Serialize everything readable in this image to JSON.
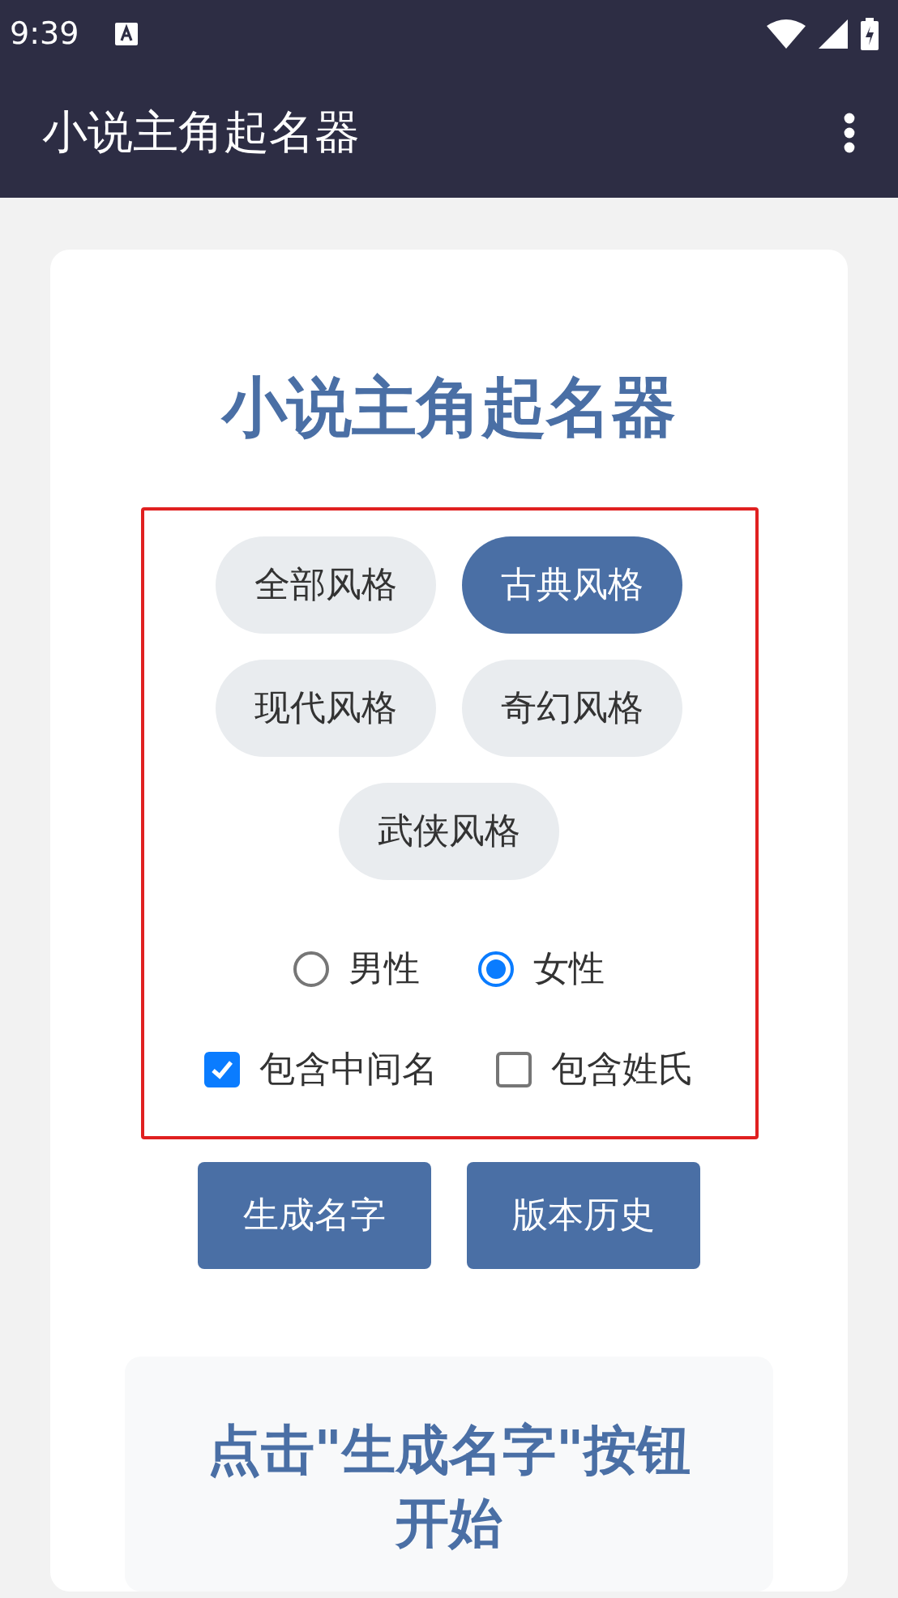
{
  "status_bar": {
    "time": "9:39"
  },
  "app_bar": {
    "title": "小说主角起名器"
  },
  "card": {
    "title": "小说主角起名器",
    "styles": [
      {
        "label": "全部风格",
        "selected": false
      },
      {
        "label": "古典风格",
        "selected": true
      },
      {
        "label": "现代风格",
        "selected": false
      },
      {
        "label": "奇幻风格",
        "selected": false
      },
      {
        "label": "武侠风格",
        "selected": false
      }
    ],
    "genders": [
      {
        "label": "男性",
        "selected": false
      },
      {
        "label": "女性",
        "selected": true
      }
    ],
    "options": [
      {
        "label": "包含中间名",
        "checked": true
      },
      {
        "label": "包含姓氏",
        "checked": false
      }
    ],
    "buttons": [
      "生成名字",
      "版本历史"
    ],
    "result": {
      "message": "点击\"生成名字\"按钮开始"
    }
  }
}
